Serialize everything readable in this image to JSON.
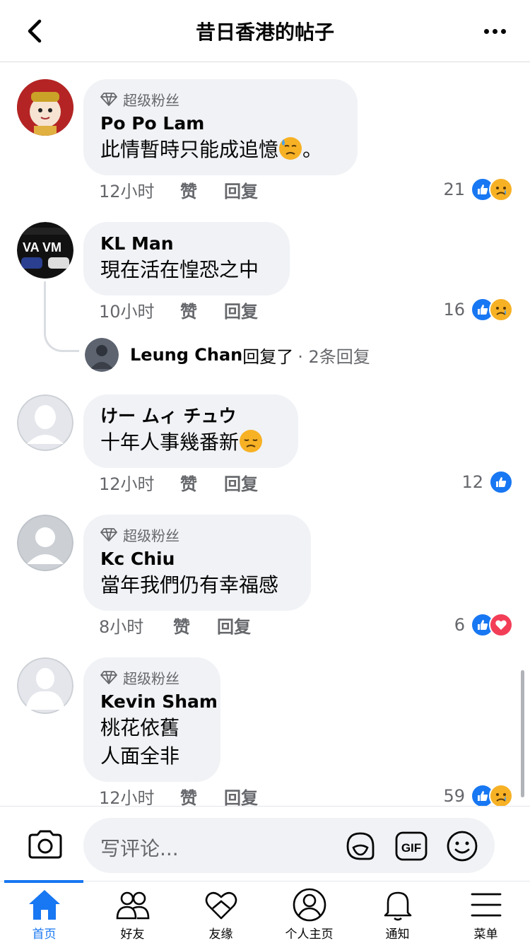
{
  "header": {
    "title": "昔日香港的帖子"
  },
  "comments": [
    {
      "author": "Po Po Lam",
      "fan_badge": "超级粉丝",
      "text": "此情暫時只能成追憶",
      "text_suffix": "。",
      "time": "12小时",
      "like": "赞",
      "reply": "回复",
      "count": "21",
      "reactions": [
        "like-icon",
        "sad-icon"
      ]
    },
    {
      "author": "KL Man",
      "text": "現在活在惶恐之中",
      "time": "10小时",
      "like": "赞",
      "reply": "回复",
      "count": "16",
      "reactions": [
        "like-icon",
        "sad-icon"
      ],
      "reply_preview": {
        "name": "Leung Chan",
        "text": "回复了",
        "count": " · 2条回复"
      }
    },
    {
      "author": "けー ムィ チュウ",
      "text": "十年人事幾番新",
      "time": "12小时",
      "like": "赞",
      "reply": "回复",
      "count": "12",
      "reactions": [
        "like-icon"
      ]
    },
    {
      "author": "Kc Chiu",
      "fan_badge": "超级粉丝",
      "text": "當年我們仍有幸福感",
      "time": "8小时",
      "like": "赞",
      "reply": "回复",
      "count": "6",
      "reactions": [
        "like-icon",
        "love-icon"
      ]
    },
    {
      "author": "Kevin Sham",
      "fan_badge": "超级粉丝",
      "text_lines": [
        "桃花依舊",
        "人面全非"
      ],
      "time": "12小时",
      "like": "赞",
      "reply": "回复",
      "count": "59",
      "reactions": [
        "like-icon",
        "sad-icon"
      ]
    }
  ],
  "composer": {
    "placeholder": "写评论..."
  },
  "tabs": [
    {
      "label": "首页",
      "icon": "home-icon",
      "active": true
    },
    {
      "label": "好友",
      "icon": "friends-icon"
    },
    {
      "label": "友缘",
      "icon": "heart-icon"
    },
    {
      "label": "个人主页",
      "icon": "profile-icon"
    },
    {
      "label": "通知",
      "icon": "bell-icon"
    },
    {
      "label": "菜单",
      "icon": "menu-icon"
    }
  ],
  "colors": {
    "accent": "#1877f2",
    "like": "#1877f2",
    "love": "#f33e58",
    "sad": "#f7b125",
    "bubble": "#f0f2f5",
    "secondary_text": "#65676b"
  }
}
